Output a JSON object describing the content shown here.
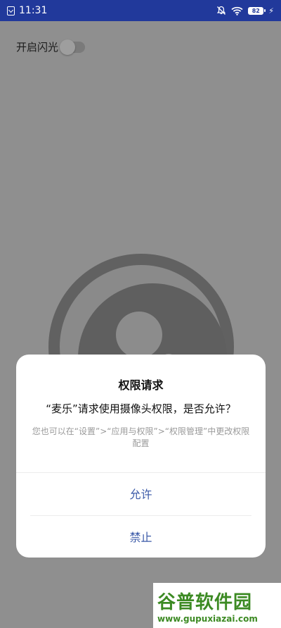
{
  "status_bar": {
    "time": "11:31",
    "battery_level": "82",
    "icons": [
      "notification-icon",
      "mute-icon",
      "wifi-icon",
      "battery-icon",
      "charging-icon"
    ]
  },
  "app": {
    "flash_label": "开启闪光",
    "flash_enabled": false
  },
  "dialog": {
    "title": "权限请求",
    "message": "“麦乐”请求使用摄像头权限，是否允许？",
    "hint": "您也可以在“设置”>“应用与权限”>“权限管理”中更改权限配置",
    "allow_label": "允许",
    "deny_label": "禁止"
  },
  "watermark": {
    "title": "谷普软件园",
    "url": "www.gupuxiazai.com"
  },
  "colors": {
    "status_bar": "#21399b",
    "scrim": "#8f8f8f",
    "dialog_button": "#3b5aa8",
    "watermark": "#3c8a23"
  }
}
